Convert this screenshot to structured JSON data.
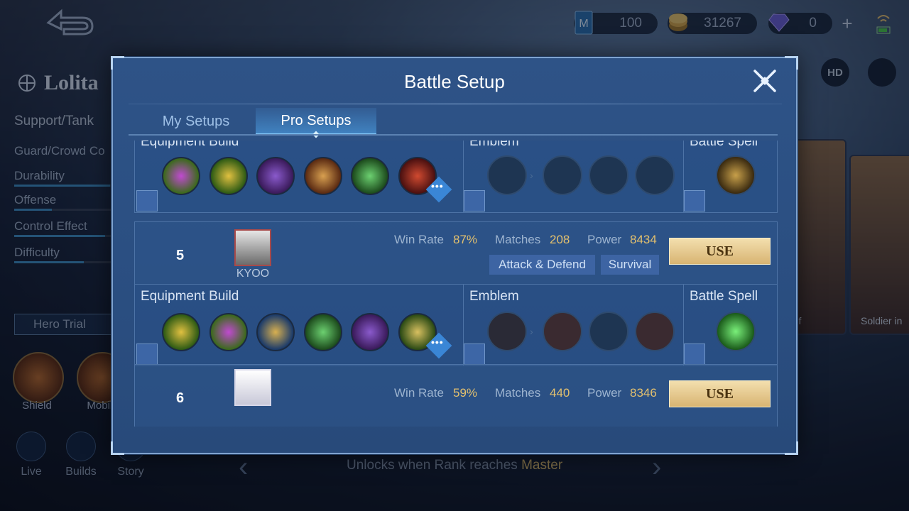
{
  "resources": {
    "ticket_count": "100",
    "coins": "31267",
    "diamonds": "0"
  },
  "hero": {
    "name": "Lolita",
    "role": "Support/Tank",
    "specialty": "Guard/Crowd Co",
    "stats": [
      {
        "label": "Durability",
        "level": 0.9
      },
      {
        "label": "Offense",
        "level": 0.35
      },
      {
        "label": "Control Effect",
        "level": 0.85
      },
      {
        "label": "Difficulty",
        "level": 0.65
      }
    ],
    "trial_label": "Hero Trial",
    "skills": [
      "Shield",
      "Mobili"
    ]
  },
  "side_cards": [
    "Elf",
    "Soldier in"
  ],
  "top_right": {
    "hd_label": "HD"
  },
  "nav": {
    "live": "Live",
    "builds": "Builds",
    "story": "Story"
  },
  "rank_notice": {
    "prefix": "Unlocks when Rank reaches",
    "rank": "Master"
  },
  "modal": {
    "title": "Battle Setup",
    "tabs": [
      {
        "label": "My Setups"
      },
      {
        "label": "Pro Setups"
      }
    ],
    "active_tab": "Pro Setups",
    "section_labels": {
      "equipment": "Equipment Build",
      "emblem": "Emblem",
      "spell": "Battle Spell"
    },
    "use_label": "USE",
    "entries": [
      {
        "rank": "5",
        "player": "KYOO",
        "win_rate_label": "Win Rate",
        "win_rate": "87%",
        "matches_label": "Matches",
        "matches": "208",
        "power_label": "Power",
        "power": "8434",
        "tags": [
          "Attack & Defend",
          "Survival"
        ]
      },
      {
        "rank": "6",
        "player": "",
        "win_rate_label": "Win Rate",
        "win_rate": "59%",
        "matches_label": "Matches",
        "matches": "440",
        "power_label": "Power",
        "power": "8346",
        "tags": []
      }
    ]
  },
  "colors": {
    "accent": "#3a86d6",
    "gold": "#e3c06e",
    "use_button": "#e6c98e"
  }
}
